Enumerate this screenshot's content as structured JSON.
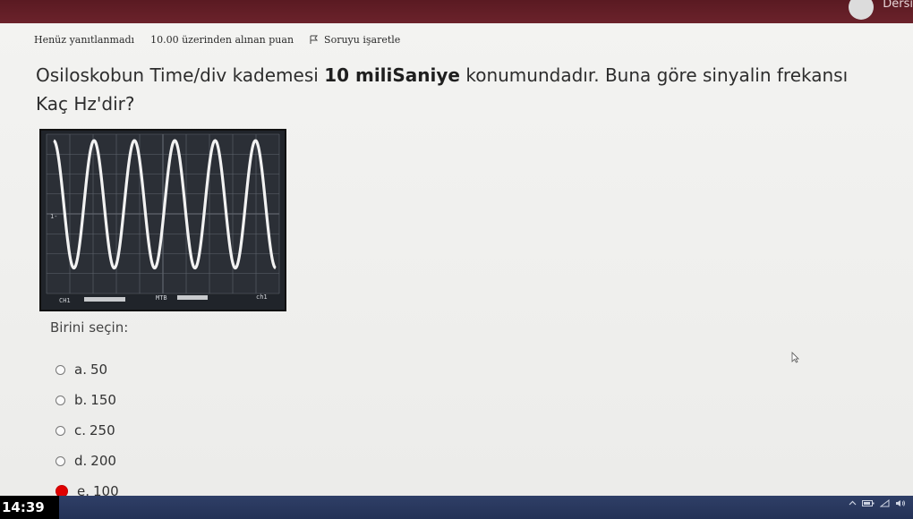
{
  "header": {
    "user_label": "Dersi"
  },
  "info": {
    "status": "Henüz yanıtlanmadı",
    "points": "10.00 üzerinden alınan puan",
    "flag_label": "Soruyu işaretle"
  },
  "question": {
    "text_before": "Osiloskobun Time/div kademesi ",
    "text_bold": "10 miliSaniye",
    "text_after": " konumundadır. Buna göre sinyalin frekansı Kaç Hz'dir?"
  },
  "scope": {
    "ch_label": "CH1",
    "mtb_label": "MTB",
    "ch_trig_label": "ch1",
    "level_marker": "1-",
    "waveform_cycles": 5.5,
    "colors": {
      "screen": "#2b2f36",
      "grid": "#5f656d",
      "trace": "#f2f2f2"
    }
  },
  "answers": {
    "prompt": "Birini seçin:",
    "options": [
      {
        "letter": "a.",
        "value": "50",
        "selected": false
      },
      {
        "letter": "b.",
        "value": "150",
        "selected": false
      },
      {
        "letter": "c.",
        "value": "250",
        "selected": false
      },
      {
        "letter": "d.",
        "value": "200",
        "selected": false
      },
      {
        "letter": "e.",
        "value": "100",
        "selected": true
      }
    ]
  },
  "taskbar": {
    "clock": "14:39",
    "tray_icons": [
      "chevron-up-icon",
      "battery-icon",
      "wifi-icon",
      "volume-icon"
    ]
  }
}
